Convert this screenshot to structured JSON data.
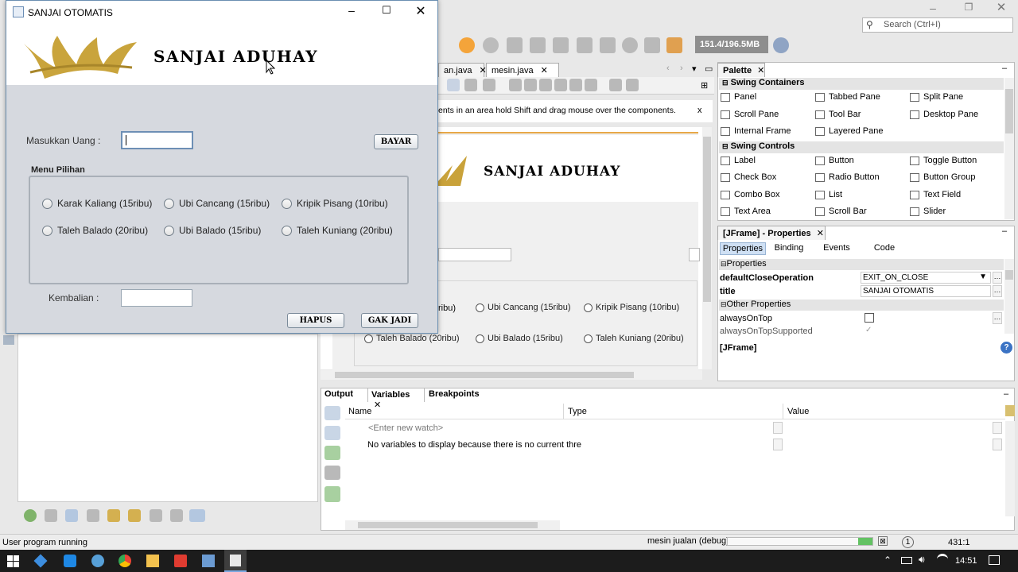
{
  "ide": {
    "memory": "151.4/196.5MB",
    "search_placeholder": "Search (Ctrl+I)",
    "editor_tabs": [
      "an.java",
      "mesin.java"
    ],
    "hint_text": "ents in an area hold Shift and drag mouse over the components.",
    "hint_close": "x",
    "designer_title": "SANJAI ADUHAY",
    "designer_radios": [
      {
        "label": "Ubi Cancang (15ribu)"
      },
      {
        "label": "Kripik Pisang (10ribu)"
      },
      {
        "label": "Taleh Balado (20ribu)"
      },
      {
        "label": "Ubi Balado (15ribu)"
      },
      {
        "label": "Taleh Kuniang (20ribu)"
      }
    ],
    "designer_partial": "ribu)",
    "palette": {
      "title": "Palette",
      "containers_header": "Swing Containers",
      "containers": [
        "Panel",
        "Tabbed Pane",
        "Split Pane",
        "Scroll Pane",
        "Tool Bar",
        "Desktop Pane",
        "Internal Frame",
        "Layered Pane"
      ],
      "controls_header": "Swing Controls",
      "controls": [
        "Label",
        "Button",
        "Toggle Button",
        "Check Box",
        "Radio Button",
        "Button Group",
        "Combo Box",
        "List",
        "Text Field",
        "Text Area",
        "Scroll Bar",
        "Slider"
      ]
    },
    "properties": {
      "title": "[JFrame] - Properties",
      "tabs": [
        "Properties",
        "Binding",
        "Events",
        "Code"
      ],
      "section1": "Properties",
      "rows": [
        {
          "name": "defaultCloseOperation",
          "value": "EXIT_ON_CLOSE"
        },
        {
          "name": "title",
          "value": "SANJAI OTOMATIS"
        }
      ],
      "section2": "Other Properties",
      "other_rows": [
        "alwaysOnTop",
        "alwaysOnTopSupported"
      ],
      "footer": "[JFrame]"
    },
    "bottom": {
      "tabs": [
        "Output",
        "Variables",
        "Breakpoints"
      ],
      "columns": [
        "Name",
        "Type",
        "Value"
      ],
      "watch_placeholder": "<Enter new watch>",
      "no_vars": "No variables to display because there is no current thre"
    },
    "status": {
      "left": "User program running",
      "session": "mesin jualan (debug)",
      "badge": "1",
      "position": "431:1"
    }
  },
  "app": {
    "window_title": "SANJAI OTOMATIS",
    "banner_title": "SANJAI ADUHAY",
    "money_label": "Masukkan Uang :",
    "money_value": "",
    "pay_button": "BAYAR",
    "menu_title": "Menu Pilihan",
    "options": [
      "Karak Kaliang (15ribu)",
      "Ubi Cancang (15ribu)",
      "Kripik Pisang (10ribu)",
      "Taleh Balado (20ribu)",
      "Ubi Balado (15ribu)",
      "Taleh Kuniang (20ribu)"
    ],
    "change_label": "Kembalian :",
    "change_value": "",
    "clear_button": "HAPUS",
    "cancel_button": "GAK JADI"
  },
  "taskbar": {
    "time": "14:51"
  }
}
